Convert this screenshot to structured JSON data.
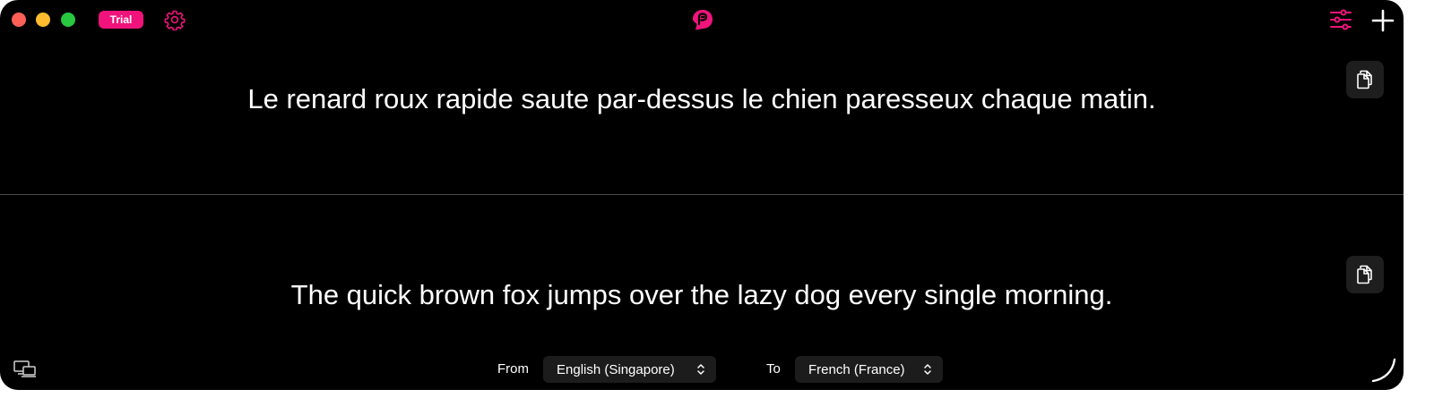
{
  "title_bar": {
    "trial_label": "Trial",
    "icons": {
      "settings": "gear-icon",
      "logo": "app-logo-icon",
      "filters": "sliders-icon",
      "add": "plus-icon"
    }
  },
  "source": {
    "text": "Le renard roux rapide saute par-dessus le chien paresseux chaque matin.",
    "copy_icon": "copy-icon"
  },
  "target": {
    "text": "The quick brown fox jumps over the lazy dog every single morning.",
    "copy_icon": "copy-icon"
  },
  "bottom_bar": {
    "devices_icon": "devices-icon",
    "from_label": "From",
    "from_value": "English (Singapore)",
    "to_label": "To",
    "to_value": "French (France)",
    "corner_icon": "resize-corner-icon"
  },
  "colors": {
    "accent": "#f0137b",
    "background": "#000000",
    "control_bg": "#1c1c1c",
    "text": "#ffffff"
  }
}
